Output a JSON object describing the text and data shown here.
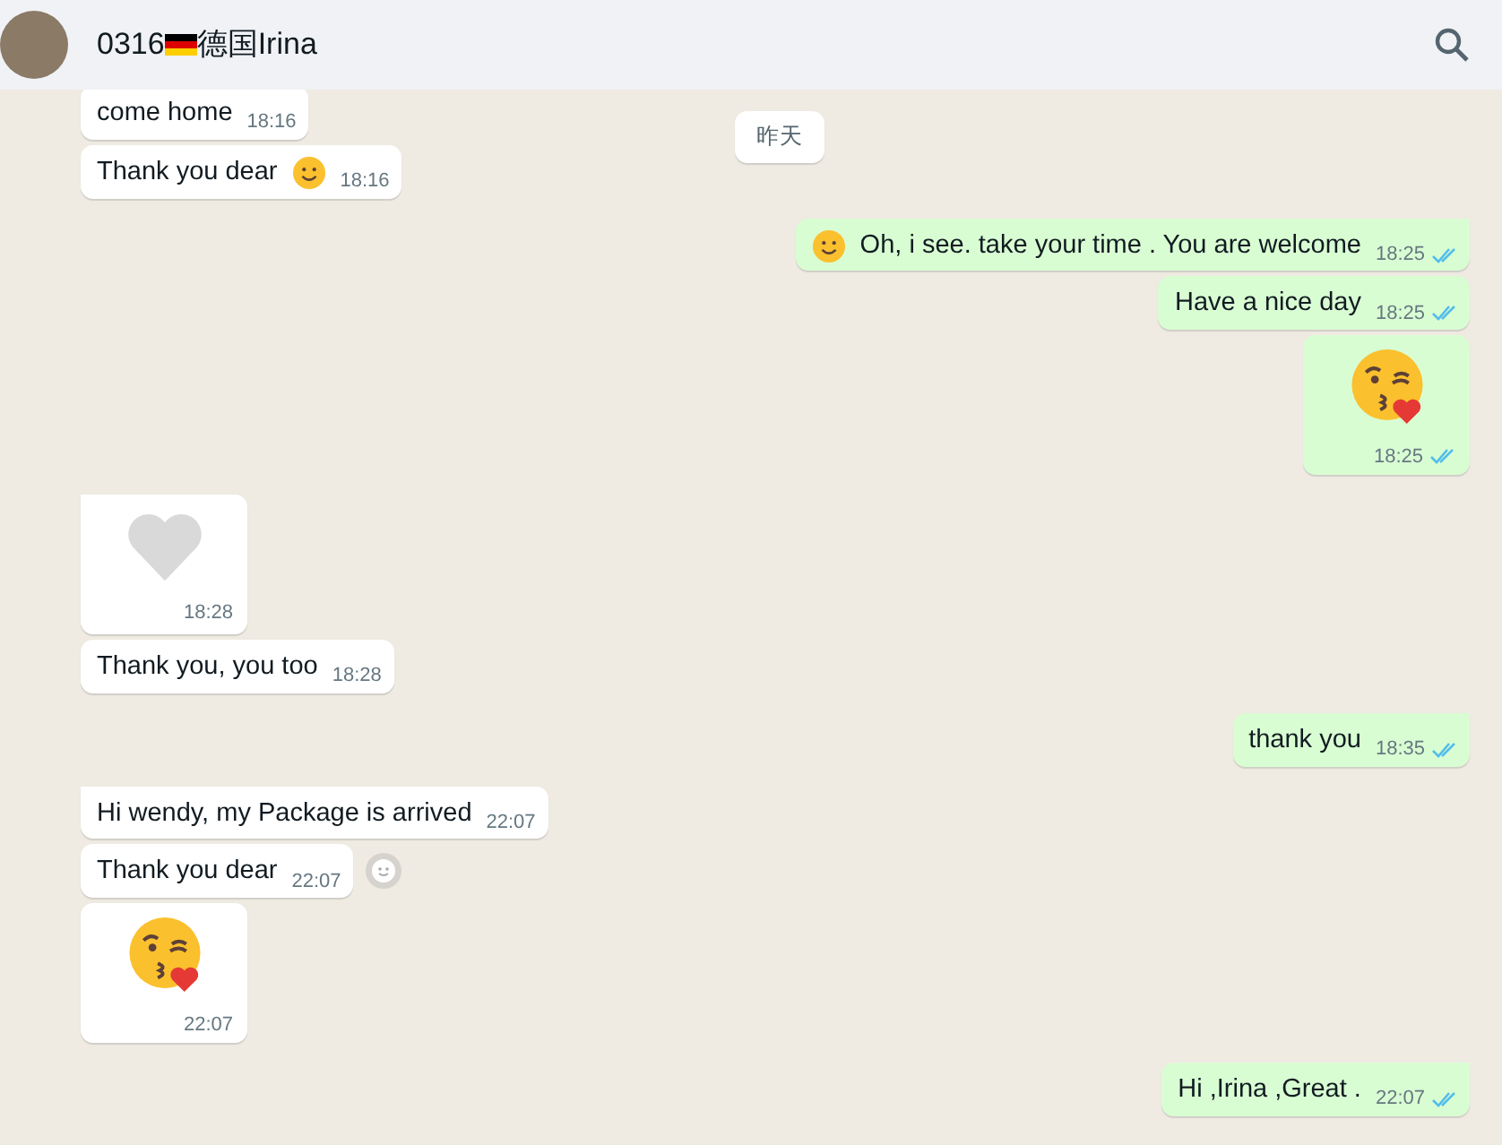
{
  "header": {
    "number": "0316",
    "name": "德国Irina"
  },
  "date_chip": "昨天",
  "groups": [
    {
      "outgoing": false,
      "messages": [
        {
          "kind": "text",
          "text": "come home",
          "time": "18:16",
          "leading_emoji": false,
          "trailing_emoji": false,
          "reaction_button": false
        },
        {
          "kind": "text",
          "text": "Thank you dear",
          "time": "18:16",
          "leading_emoji": false,
          "trailing_emoji": true,
          "reaction_button": false
        }
      ]
    },
    {
      "outgoing": true,
      "messages": [
        {
          "kind": "text",
          "text": "Oh, i see.  take your time .  You are welcome",
          "time": "18:25",
          "read": true,
          "leading_emoji": true,
          "trailing_emoji": false,
          "reaction_button": false
        },
        {
          "kind": "text",
          "text": "Have a nice day",
          "time": "18:25",
          "read": true,
          "leading_emoji": false,
          "trailing_emoji": false,
          "reaction_button": false
        },
        {
          "kind": "kiss",
          "time": "18:25",
          "read": true,
          "reaction_button": false
        }
      ]
    },
    {
      "outgoing": false,
      "messages": [
        {
          "kind": "heart",
          "time": "18:28",
          "reaction_button": false
        },
        {
          "kind": "text",
          "text": "Thank you, you too",
          "time": "18:28",
          "leading_emoji": false,
          "trailing_emoji": false,
          "reaction_button": false
        }
      ]
    },
    {
      "outgoing": true,
      "messages": [
        {
          "kind": "text",
          "text": "thank you",
          "time": "18:35",
          "read": true,
          "leading_emoji": false,
          "trailing_emoji": false,
          "reaction_button": false
        }
      ]
    },
    {
      "outgoing": false,
      "messages": [
        {
          "kind": "text",
          "text": "Hi wendy, my Package is arrived",
          "time": "22:07",
          "leading_emoji": false,
          "trailing_emoji": false,
          "reaction_button": false
        },
        {
          "kind": "text",
          "text": "Thank you dear",
          "time": "22:07",
          "leading_emoji": false,
          "trailing_emoji": false,
          "reaction_button": true
        },
        {
          "kind": "kiss",
          "time": "22:07",
          "reaction_button": false
        }
      ]
    },
    {
      "outgoing": true,
      "messages": [
        {
          "kind": "text",
          "text": "Hi ,Irina ,Great .",
          "time": "22:07",
          "read": true,
          "leading_emoji": false,
          "trailing_emoji": false,
          "reaction_button": false
        }
      ]
    }
  ]
}
